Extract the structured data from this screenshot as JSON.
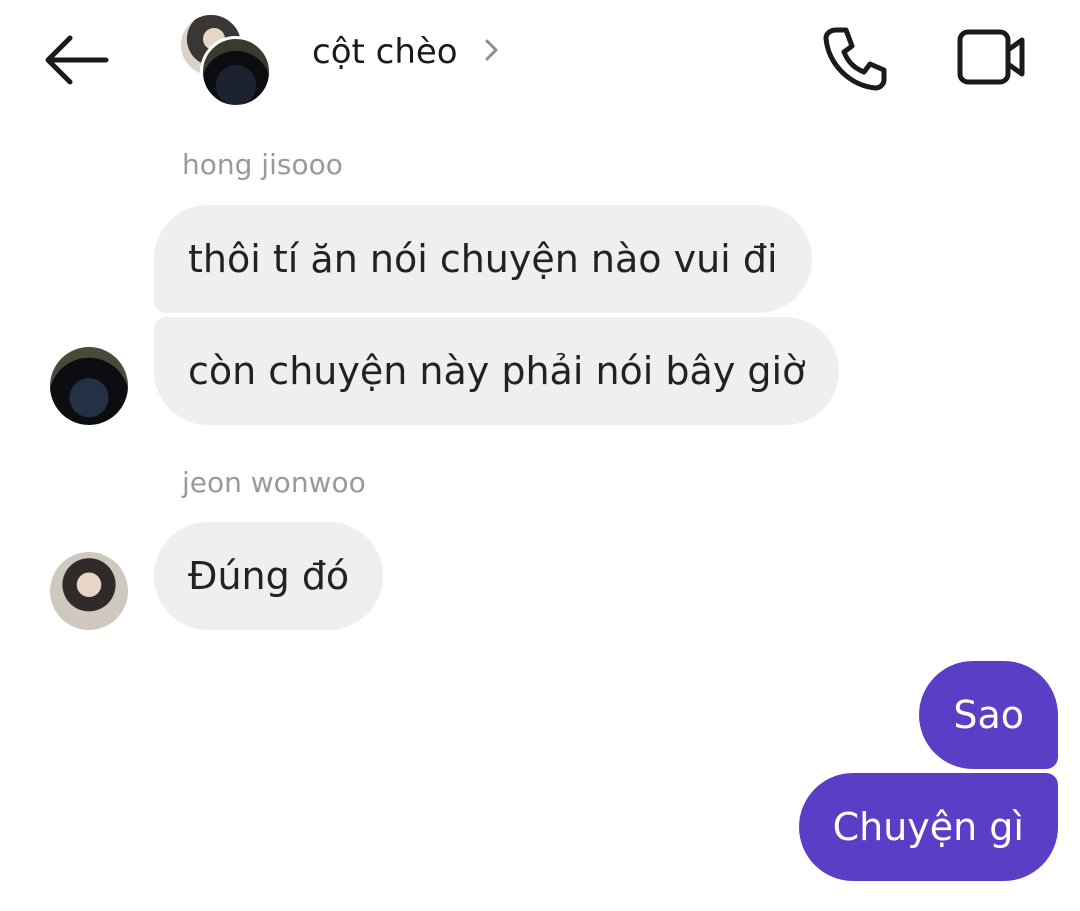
{
  "header": {
    "title": "cột chèo",
    "back_icon": "arrow-left-icon",
    "chevron_icon": "chevron-right-icon",
    "call_icon": "phone-icon",
    "video_icon": "video-camera-icon"
  },
  "messages": [
    {
      "sender": "hong jisooo",
      "text": "thôi tí ăn nói chuyện nào vui đi",
      "direction": "incoming"
    },
    {
      "sender": "hong jisooo",
      "text": "còn chuyện này phải nói bây giờ",
      "direction": "incoming"
    },
    {
      "sender": "jeon wonwoo",
      "text": "Đúng đó",
      "direction": "incoming"
    },
    {
      "sender": "",
      "text": "Sao",
      "direction": "outgoing"
    },
    {
      "sender": "",
      "text": "Chuyện gì",
      "direction": "outgoing"
    }
  ],
  "colors": {
    "incoming_bubble": "#efefef",
    "outgoing_bubble": "#5a3fc6",
    "sender_label": "#9a9a9a"
  }
}
